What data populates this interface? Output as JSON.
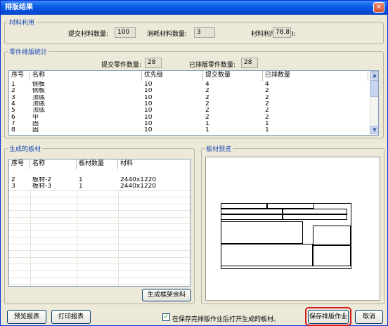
{
  "window": {
    "title": "排版结果",
    "close_symbol": "✕"
  },
  "material_usage": {
    "title": "材料利用",
    "submitted_label": "提交材料数量:",
    "submitted_value": "100",
    "consumed_label": "消耗材料数量:",
    "consumed_value": "3",
    "rate_label": "材料利用率(%):",
    "rate_value": "78.8"
  },
  "parts_stats": {
    "title": "零件排版统计",
    "submitted_label": "提交零件数量:",
    "submitted_value": "28",
    "nested_label": "已排版零件数量:",
    "nested_value": "28",
    "columns": [
      "序号",
      "名称",
      "优先级",
      "提交数量",
      "已排数量"
    ],
    "rows": [
      [
        "1",
        "侧板",
        "10",
        "4",
        "4"
      ],
      [
        "2",
        "侧板",
        "10",
        "2",
        "2"
      ],
      [
        "3",
        "顶底",
        "10",
        "2",
        "2"
      ],
      [
        "4",
        "顶底",
        "10",
        "2",
        "2"
      ],
      [
        "5",
        "顶底",
        "10",
        "2",
        "2"
      ],
      [
        "6",
        "中",
        "10",
        "2",
        "2"
      ],
      [
        "7",
        "固",
        "10",
        "1",
        "1"
      ],
      [
        "8",
        "固",
        "10",
        "1",
        "1"
      ]
    ]
  },
  "boards": {
    "title": "生成的板材",
    "columns": [
      "序号",
      "名称",
      "板材数量",
      "材料"
    ],
    "rows": [
      [
        "1",
        "板材-1",
        "1",
        "2440x1220"
      ],
      [
        "2",
        "板材-2",
        "1",
        "2440x1220"
      ],
      [
        "3",
        "板材-3",
        "1",
        "2440x1220"
      ]
    ],
    "selected_index": 0,
    "generate_frame_button": "生成框架余料"
  },
  "preview": {
    "title": "板材预览"
  },
  "footer": {
    "preview_report_button": "预览报表",
    "print_report_button": "打印报表",
    "open_after_save_checkbox": "在保存完排版作业后打开生成的板材。",
    "open_after_save_checked": true,
    "save_job_button": "保存排版作业",
    "cancel_button": "取消"
  },
  "icons": {
    "scroll_up": "chevron-up-icon",
    "scroll_down": "chevron-down-icon",
    "checkmark": "checkmark-icon"
  }
}
